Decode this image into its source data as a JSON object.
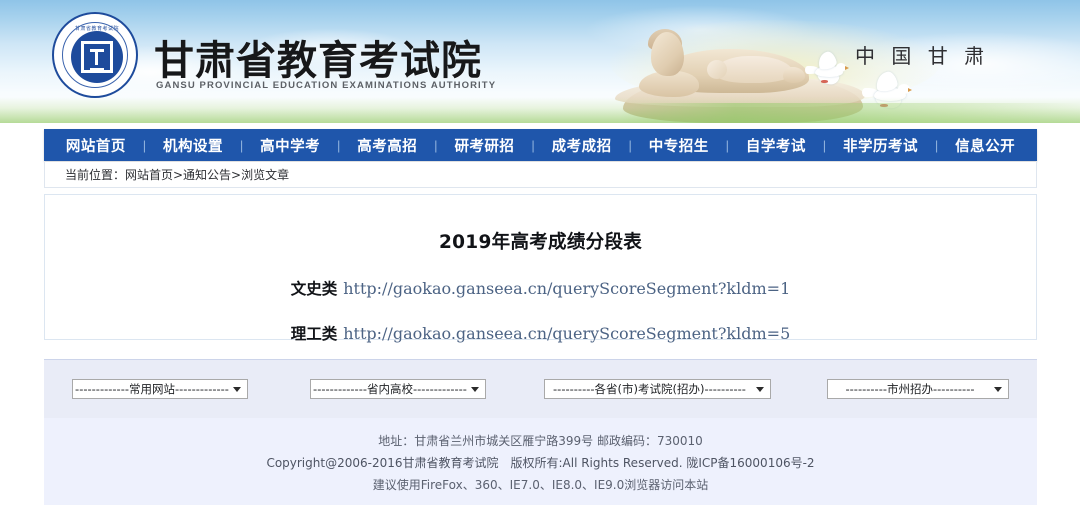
{
  "site": {
    "logo_icon": "gansu-education-seal-icon",
    "seal_arc_top": "甘肃省教育考试院",
    "seal_arc_bottom": "GANSU PROVINCIAL EDUCATION EXAMINATIONS AUTHORITY",
    "name_cn": "甘肃省教育考试院",
    "name_en": "GANSU PROVINCIAL EDUCATION EXAMINATIONS AUTHORITY",
    "banner_text": "中 国  甘 肃"
  },
  "nav": {
    "separator": "|",
    "items": [
      {
        "label": "网站首页"
      },
      {
        "label": "机构设置"
      },
      {
        "label": "高中学考"
      },
      {
        "label": "高考高招"
      },
      {
        "label": "研考研招"
      },
      {
        "label": "成考成招"
      },
      {
        "label": "中专招生"
      },
      {
        "label": "自学考试"
      },
      {
        "label": "非学历考试"
      },
      {
        "label": "信息公开"
      }
    ]
  },
  "breadcrumb": {
    "text": "当前位置：网站首页>通知公告>浏览文章"
  },
  "article": {
    "title": "2019年高考成绩分段表",
    "links": [
      {
        "label": "文史类",
        "url": "http://gaokao.ganseea.cn/queryScoreSegment?kldm=1"
      },
      {
        "label": "理工类",
        "url": "http://gaokao.ganseea.cn/queryScoreSegment?kldm=5"
      }
    ]
  },
  "quicklinks": {
    "selects": [
      {
        "name": "common-sites",
        "value": "-------------常用网站-------------",
        "arrow_icon": "chevron-down-icon"
      },
      {
        "name": "provincial-colleges",
        "value": "-------------省内高校-------------",
        "arrow_icon": "chevron-down-icon"
      },
      {
        "name": "provincial-exam-authorities",
        "value": "----------各省(市)考试院(招办)----------",
        "arrow_icon": "chevron-down-icon"
      },
      {
        "name": "city-admissions-offices",
        "value": "----------市州招办----------",
        "arrow_icon": "chevron-down-icon"
      }
    ]
  },
  "footer": {
    "line1": "地址：甘肃省兰州市城关区雁宁路399号 邮政编码：730010",
    "line2": "Copyright@2006-2016甘肃省教育考试院　版权所有:All Rights Reserved. 陇ICP备16000106号-2",
    "line3": "建议使用FireFox、360、IE7.0、IE8.0、IE9.0浏览器访问本站"
  },
  "colors": {
    "nav_blue": "#1f56ab",
    "seal_blue": "#1e4b9c",
    "link_url": "#4c6384",
    "quicklinks_bg": "#e9ecf7",
    "footer_bg": "#eef1fd"
  }
}
